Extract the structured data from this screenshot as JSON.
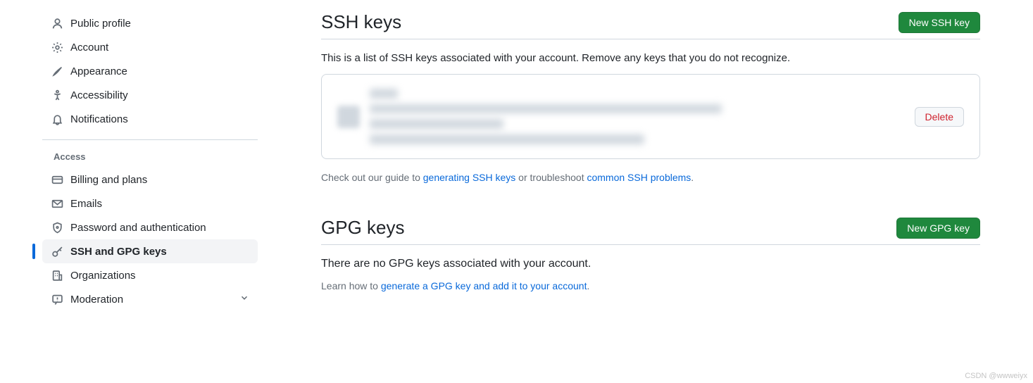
{
  "sidebar": {
    "items": [
      {
        "label": "Public profile"
      },
      {
        "label": "Account"
      },
      {
        "label": "Appearance"
      },
      {
        "label": "Accessibility"
      },
      {
        "label": "Notifications"
      }
    ],
    "access_group": {
      "title": "Access",
      "items": [
        {
          "label": "Billing and plans"
        },
        {
          "label": "Emails"
        },
        {
          "label": "Password and authentication"
        },
        {
          "label": "SSH and GPG keys"
        },
        {
          "label": "Organizations"
        },
        {
          "label": "Moderation"
        }
      ]
    }
  },
  "ssh": {
    "title": "SSH keys",
    "new_button": "New SSH key",
    "desc": "This is a list of SSH keys associated with your account. Remove any keys that you do not recognize.",
    "delete_label": "Delete",
    "help_prefix": "Check out our guide to ",
    "help_link1": "generating SSH keys",
    "help_middle": " or troubleshoot ",
    "help_link2": "common SSH problems",
    "help_suffix": "."
  },
  "gpg": {
    "title": "GPG keys",
    "new_button": "New GPG key",
    "empty": "There are no GPG keys associated with your account.",
    "help_prefix": "Learn how to ",
    "help_link": "generate a GPG key and add it to your account",
    "help_suffix": "."
  },
  "watermark": "CSDN @wwweiyx"
}
